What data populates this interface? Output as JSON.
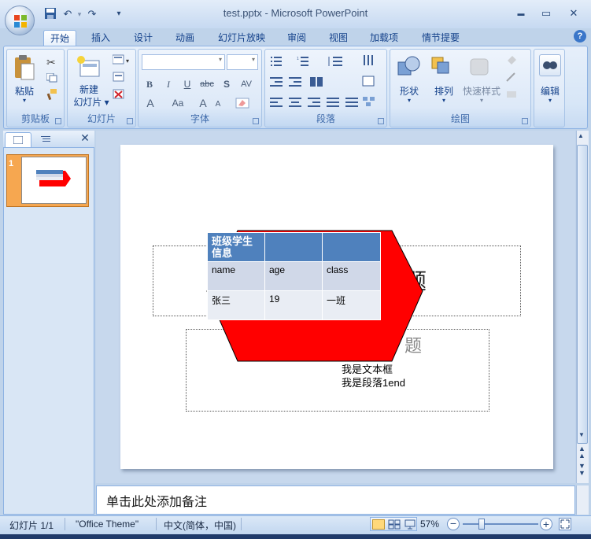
{
  "titlebar": {
    "title": "test.pptx - Microsoft PowerPoint",
    "qat_more": "▾",
    "minimize": "▬",
    "maximize": "▭",
    "close": "✕"
  },
  "tabs": [
    {
      "label": "开始",
      "active": true
    },
    {
      "label": "插入"
    },
    {
      "label": "设计"
    },
    {
      "label": "动画"
    },
    {
      "label": "幻灯片放映"
    },
    {
      "label": "审阅"
    },
    {
      "label": "视图"
    },
    {
      "label": "加载项"
    },
    {
      "label": "情节提要"
    }
  ],
  "help": "?",
  "ribbon": {
    "clipboard": {
      "paste": "粘贴",
      "label": "剪贴板"
    },
    "slides": {
      "new_slide_line1": "新建",
      "new_slide_line2": "幻灯片",
      "label": "幻灯片"
    },
    "font": {
      "label": "字体",
      "bold": "B",
      "italic": "I",
      "underline": "U",
      "strike": "abc",
      "shadow": "S",
      "spacing": "AV",
      "font_color": "A",
      "case": "Aa",
      "grow": "A",
      "shrink": "A"
    },
    "paragraph": {
      "label": "段落"
    },
    "drawing": {
      "shapes": "形状",
      "arrange": "排列",
      "quick_styles": "快速样式",
      "label": "绘图"
    },
    "editing": {
      "label": "编辑"
    }
  },
  "slides_pane": {
    "slide_number": "1",
    "close": "✕"
  },
  "slide": {
    "title_placeholder_partial": "题",
    "subtitle_placeholder_partial": "题",
    "textbox_line1": "我是文本框",
    "textbox_line2": "我是段落1end",
    "table": {
      "header": [
        "班级学生信息",
        "",
        ""
      ],
      "rows": [
        [
          "name",
          "age",
          "class"
        ],
        [
          "张三",
          "19",
          "一班"
        ]
      ]
    },
    "shape_color": "#ff0000",
    "table_header_color": "#4f81bd"
  },
  "notes": {
    "placeholder": "单击此处添加备注"
  },
  "statusbar": {
    "slide_info": "幻灯片 1/1",
    "theme": "\"Office Theme\"",
    "language": "中文(简体，中国)",
    "zoom": "57%"
  }
}
